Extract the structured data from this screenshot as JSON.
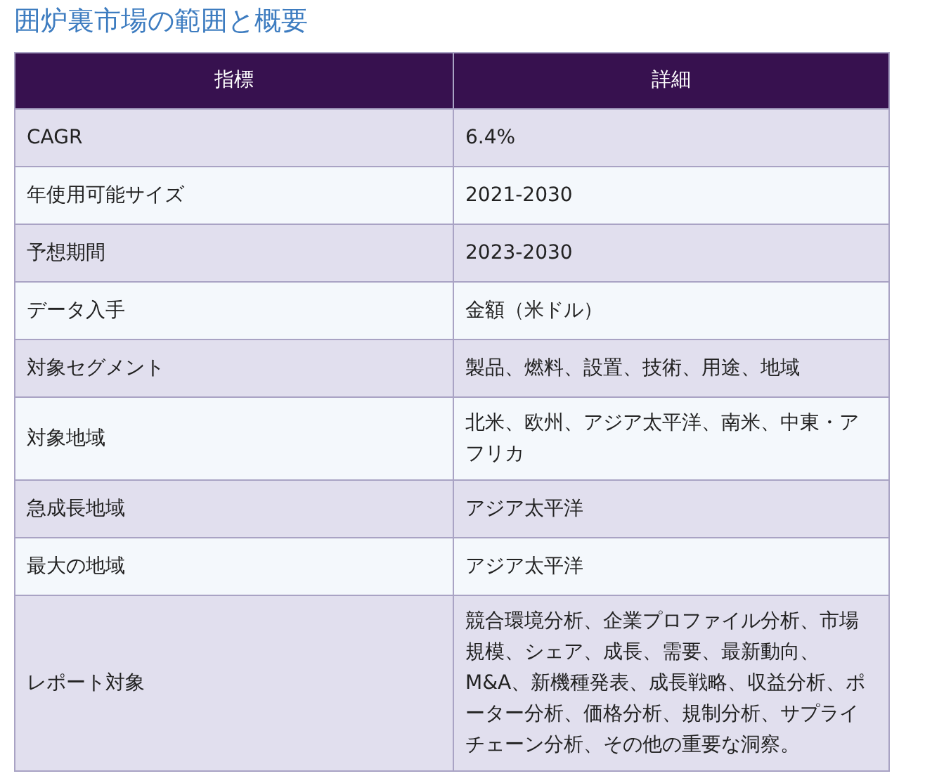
{
  "title": "囲炉裏市場の範囲と概要",
  "table": {
    "columns": [
      "指標",
      "詳細"
    ],
    "rows": [
      [
        "CAGR",
        "6.4%"
      ],
      [
        "年使用可能サイズ",
        "2021-2030"
      ],
      [
        "予想期間",
        "2023-2030"
      ],
      [
        "データ入手",
        "金額（米ドル）"
      ],
      [
        "対象セグメント",
        "製品、燃料、設置、技術、用途、地域"
      ],
      [
        "対象地域",
        "北米、欧州、アジア太平洋、南米、中東・アフリカ"
      ],
      [
        "急成長地域",
        "アジア太平洋"
      ],
      [
        "最大の地域",
        "アジア太平洋"
      ],
      [
        "レポート対象",
        "競合環境分析、企業プロファイル分析、市場規模、シェア、成長、需要、最新動向、M&A、新機種発表、成長戦略、収益分析、ポーター分析、価格分析、規制分析、サプライチェーン分析、その他の重要な洞察。"
      ]
    ]
  }
}
